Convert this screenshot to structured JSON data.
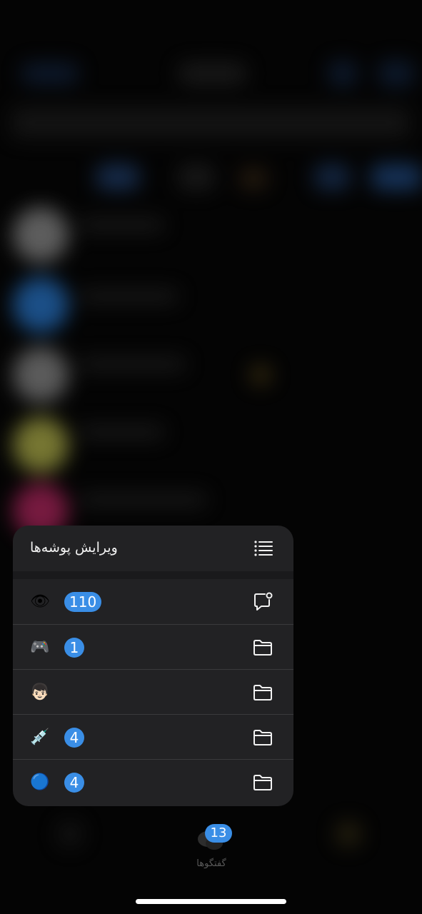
{
  "menu": {
    "title": "ویرایش پوشه‌ها",
    "header_icon": "list-icon",
    "items": [
      {
        "emoji": "👁",
        "badge": "110",
        "icon": "chat-bubble-icon"
      },
      {
        "emoji": "🎮",
        "badge": "1",
        "icon": "folder-icon"
      },
      {
        "emoji": "👦🏻",
        "badge": "",
        "icon": "folder-icon"
      },
      {
        "emoji": "💉",
        "badge": "4",
        "icon": "folder-icon"
      },
      {
        "emoji": "🔵",
        "badge": "4",
        "icon": "folder-icon"
      }
    ]
  },
  "tabbar": {
    "chats_label": "گفتگوها",
    "chats_badge": "13"
  },
  "colors": {
    "accent": "#3a8ee6",
    "menu_bg": "#222224",
    "separator": "#3a3a3c"
  }
}
